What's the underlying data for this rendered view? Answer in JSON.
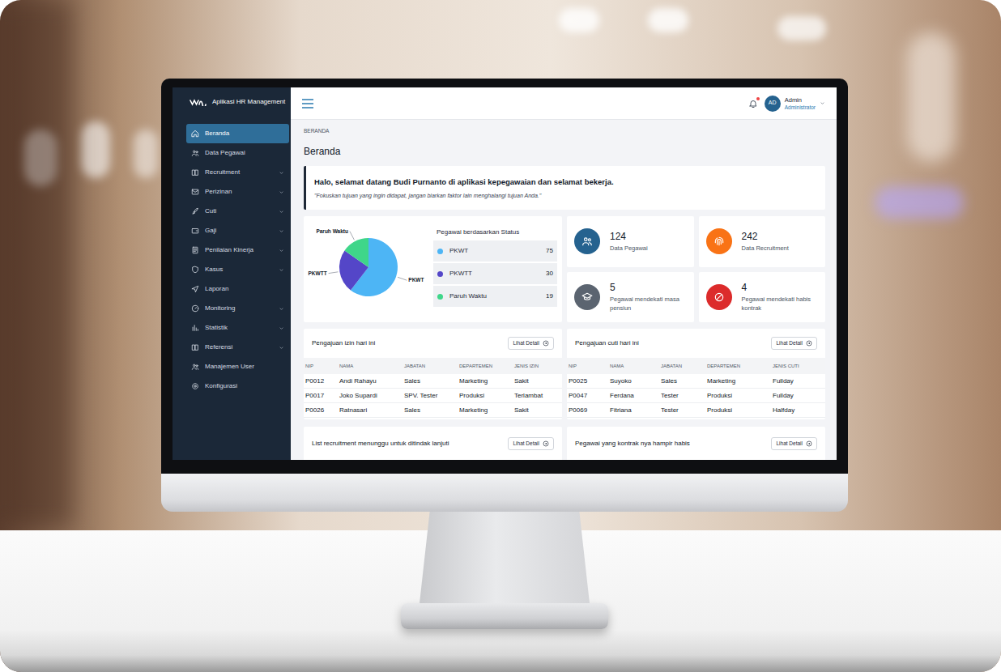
{
  "app": {
    "title": "Aplikasi HR Management"
  },
  "sidebar": {
    "items": [
      {
        "label": "Beranda",
        "kind": "home",
        "has_submenu": false,
        "selected": true
      },
      {
        "label": "Data Pegawai",
        "kind": "users",
        "has_submenu": false,
        "selected": false
      },
      {
        "label": "Recruitment",
        "kind": "book",
        "has_submenu": true,
        "selected": false
      },
      {
        "label": "Perizinan",
        "kind": "mail",
        "has_submenu": true,
        "selected": false
      },
      {
        "label": "Cuti",
        "kind": "rocket",
        "has_submenu": true,
        "selected": false
      },
      {
        "label": "Gaji",
        "kind": "wallet",
        "has_submenu": true,
        "selected": false
      },
      {
        "label": "Penilaian Kinerja",
        "kind": "doc",
        "has_submenu": true,
        "selected": false
      },
      {
        "label": "Kasus",
        "kind": "shield",
        "has_submenu": true,
        "selected": false
      },
      {
        "label": "Laporan",
        "kind": "send",
        "has_submenu": false,
        "selected": false
      },
      {
        "label": "Monitoring",
        "kind": "gauge",
        "has_submenu": true,
        "selected": false
      },
      {
        "label": "Statistik",
        "kind": "chart",
        "has_submenu": true,
        "selected": false
      },
      {
        "label": "Referensi",
        "kind": "book",
        "has_submenu": true,
        "selected": false
      },
      {
        "label": "Manajemen User",
        "kind": "users",
        "has_submenu": false,
        "selected": false
      },
      {
        "label": "Konfigurasi",
        "kind": "gear",
        "has_submenu": false,
        "selected": false
      }
    ]
  },
  "topbar": {
    "notification": {
      "unread": true
    },
    "user": {
      "initials": "AD",
      "name": "Admin",
      "role": "Administrator"
    }
  },
  "breadcrumb": "BERANDA",
  "page_title": "Beranda",
  "welcome": {
    "greeting": "Halo, selamat datang Budi Purnanto di aplikasi kepegawaian dan selamat bekerja.",
    "quote": "\"Fokuskan tujuan yang ingin didapat, jangan biarkan faktor lain menghalangi tujuan Anda.\""
  },
  "status_chart": {
    "title": "Pegawai berdasarkan Status",
    "slices": [
      {
        "label": "PKWT",
        "value": 75,
        "color": "#4db5f5"
      },
      {
        "label": "PKWTT",
        "value": 30,
        "color": "#5446c8"
      },
      {
        "label": "Paruh Waktu",
        "value": 19,
        "color": "#3fd68a"
      }
    ],
    "legend": [
      {
        "label": "PKWT",
        "count": "75",
        "color": "#4db5f5"
      },
      {
        "label": "PKWTT",
        "count": "30",
        "color": "#5446c8"
      },
      {
        "label": "Paruh Waktu",
        "count": "19",
        "color": "#3fd68a"
      }
    ]
  },
  "stats": [
    {
      "value": "124",
      "label": "Data Pegawai",
      "kind": "users",
      "color": "#25628f"
    },
    {
      "value": "242",
      "label": "Data Recruitment",
      "kind": "fingerprint",
      "color": "#f97316"
    },
    {
      "value": "5",
      "label": "Pegawai mendekati masa pensiun",
      "kind": "graduation",
      "color": "#5b6470"
    },
    {
      "value": "4",
      "label": "Pegawai mendekati habis kontrak",
      "kind": "block",
      "color": "#dc2b2b"
    }
  ],
  "leave_tables": [
    {
      "title": "Pengajuan izin hari ini",
      "button": "Lihat Detail",
      "columns": [
        "NIP",
        "NAMA",
        "JABATAN",
        "DEPARTEMEN",
        "JENIS IZIN"
      ],
      "rows": [
        [
          "P0012",
          "Andi Rahayu",
          "Sales",
          "Marketing",
          "Sakit"
        ],
        [
          "P0017",
          "Joko Supardi",
          "SPV. Tester",
          "Produksi",
          "Terlambat"
        ],
        [
          "P0026",
          "Ratnasari",
          "Sales",
          "Marketing",
          "Sakit"
        ]
      ]
    },
    {
      "title": "Pengajuan cuti hari ini",
      "button": "Lihat Detail",
      "columns": [
        "NIP",
        "NAMA",
        "JABATAN",
        "DEPARTEMEN",
        "JENIS CUTI"
      ],
      "rows": [
        [
          "P0025",
          "Suyoko",
          "Sales",
          "Marketing",
          "Fullday"
        ],
        [
          "P0047",
          "Ferdana",
          "Tester",
          "Produksi",
          "Fullday"
        ],
        [
          "P0069",
          "Fitriana",
          "Tester",
          "Produksi",
          "Halfday"
        ]
      ]
    }
  ],
  "bottom_cards": [
    {
      "title": "List recruitment menunggu untuk ditindak lanjuti",
      "button": "Lihat Detail"
    },
    {
      "title": "Pegawai yang kontrak nya hampir habis",
      "button": "Lihat Detail"
    }
  ]
}
